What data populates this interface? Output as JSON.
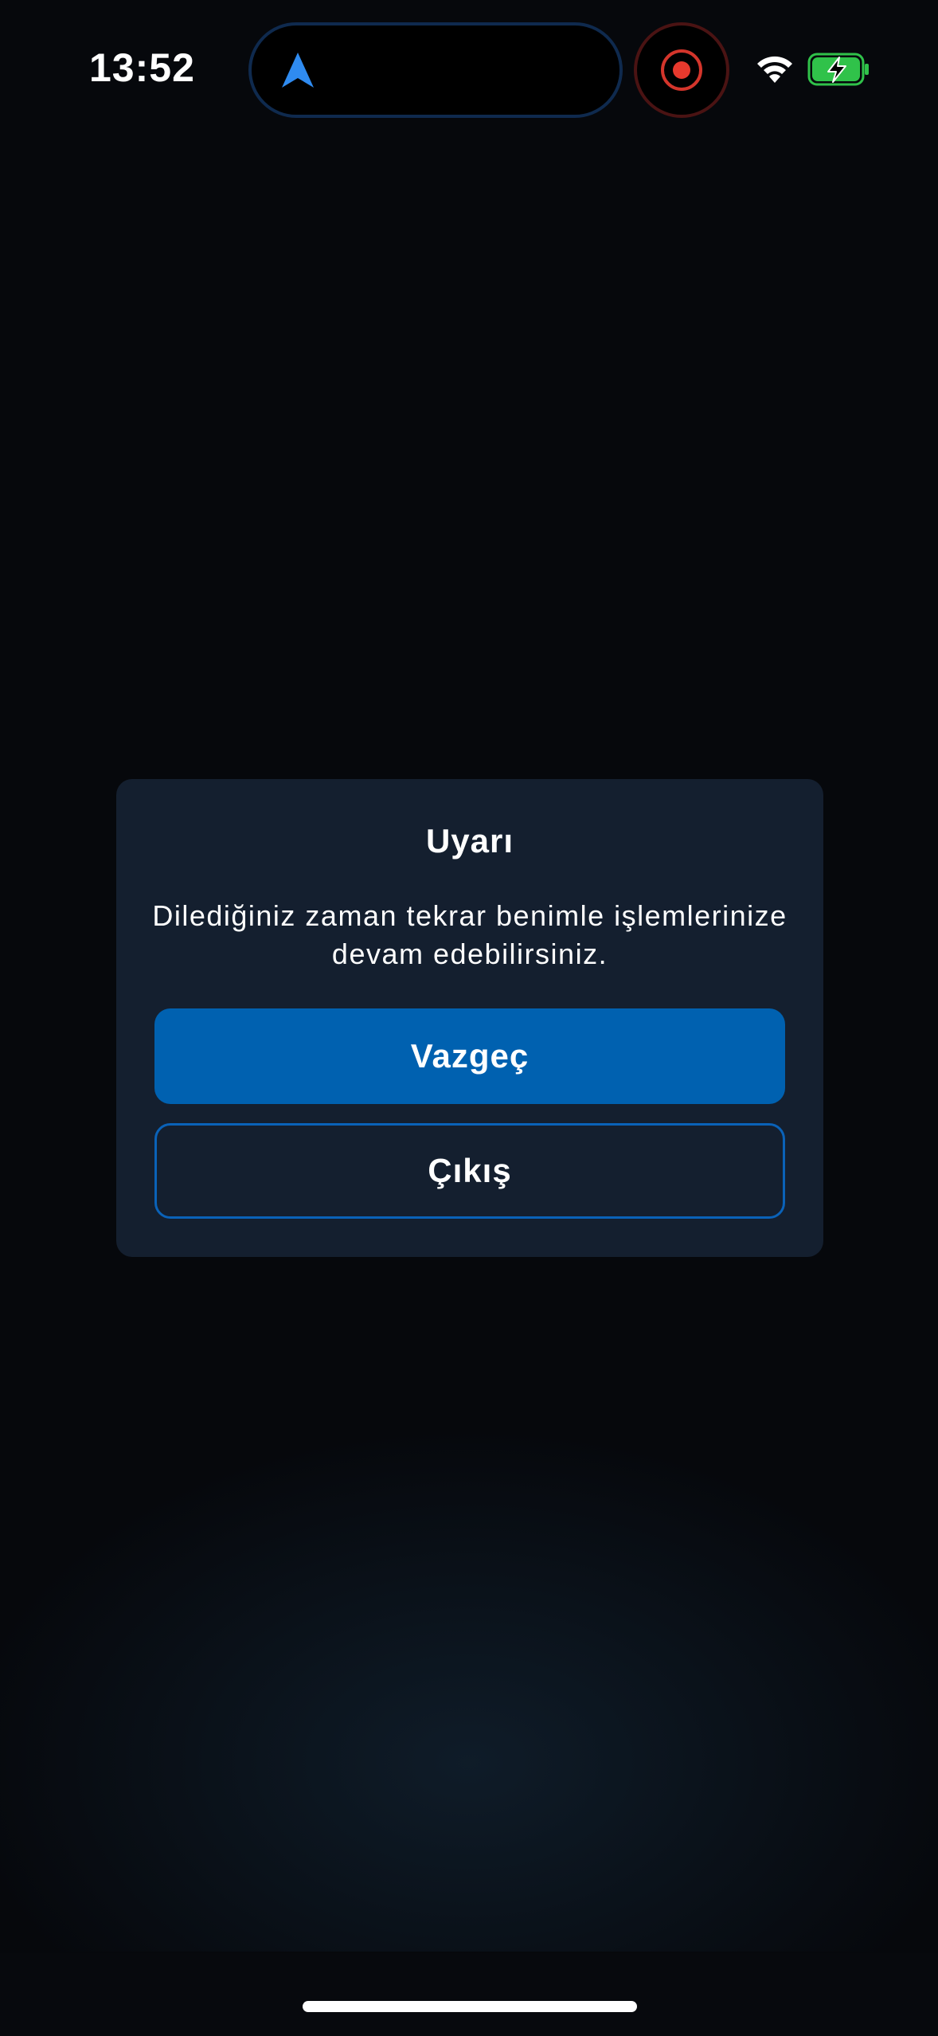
{
  "status_bar": {
    "time": "13:52",
    "icons": [
      "navigation-arrow-icon",
      "screen-record-icon",
      "wifi-icon",
      "battery-charging-icon"
    ],
    "colors": {
      "navigation": "#2f8bf0",
      "recording": "#e8392d",
      "battery": "#30c24a"
    }
  },
  "dialog": {
    "title": "Uyarı",
    "message": "Dilediğiniz zaman tekrar benimle işlemlerinize devam edebilirsiniz.",
    "primary_button": "Vazgeç",
    "secondary_button": "Çıkış",
    "colors": {
      "background": "#141f2f",
      "primary": "#0061b0",
      "outline": "#0a62b8"
    }
  }
}
